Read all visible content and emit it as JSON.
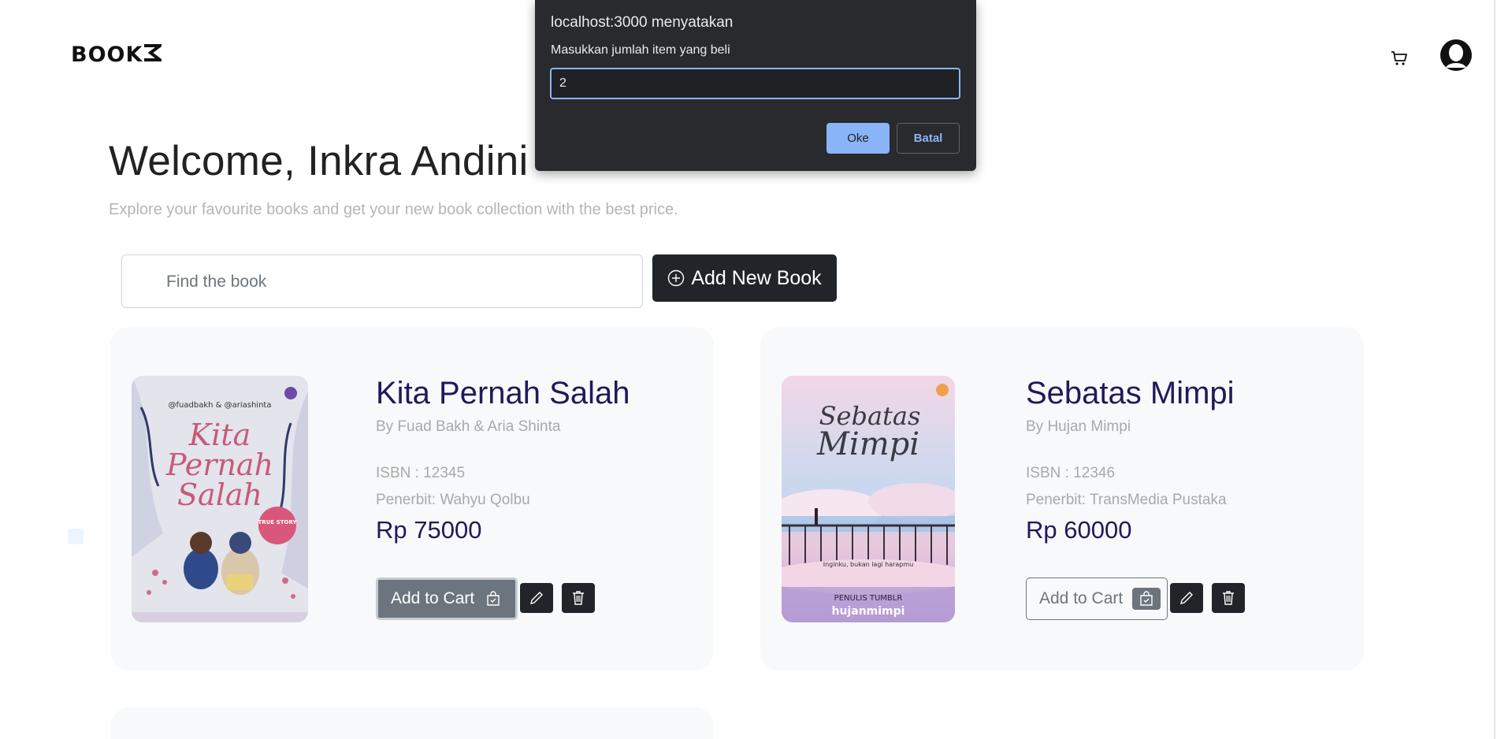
{
  "header": {
    "logo_text": "BOOK",
    "cart_icon": "cart-icon",
    "avatar_icon": "user-avatar"
  },
  "hero": {
    "welcome": "Welcome, Inkra Andini",
    "subtitle": "Explore your favourite books and get your new book collection with the best price."
  },
  "search": {
    "placeholder": "Find the book",
    "value": ""
  },
  "add_book": {
    "label": "Add New Book",
    "icon": "plus-circle-icon"
  },
  "books": [
    {
      "title": "Kita Pernah Salah",
      "author": "By Fuad Bakh & Aria Shinta",
      "isbn": "ISBN : 12345",
      "publisher": "Penerbit: Wahyu Qolbu",
      "price": "Rp 75000",
      "cart_label": "Add to Cart",
      "cover": {
        "top_text": "@fuadbakh & @ariashinta",
        "title_lines": [
          "Kita",
          "Pernah",
          "Salah"
        ],
        "badge": "TRUE STORY"
      }
    },
    {
      "title": "Sebatas Mimpi",
      "author": "By Hujan Mimpi",
      "isbn": "ISBN : 12346",
      "publisher": "Penerbit: TransMedia Pustaka",
      "price": "Rp 60000",
      "cart_label": "Add to Cart",
      "cover": {
        "title_lines": [
          "Sebatas",
          "Mimpi"
        ],
        "tagline": "Inginku, bukan lagi harapmu",
        "author_label": "PENULIS TUMBLR",
        "author_handle": "hujanmimpi"
      }
    }
  ],
  "dialog": {
    "title": "localhost:3000 menyatakan",
    "message": "Masukkan jumlah item yang beli",
    "input_value": "2",
    "ok_label": "Oke",
    "cancel_label": "Batal"
  },
  "colors": {
    "accent_dark": "#212529",
    "title_navy": "#1d1a5c",
    "dialog_bg": "#292a2d",
    "dialog_accent": "#8ab4f8"
  }
}
